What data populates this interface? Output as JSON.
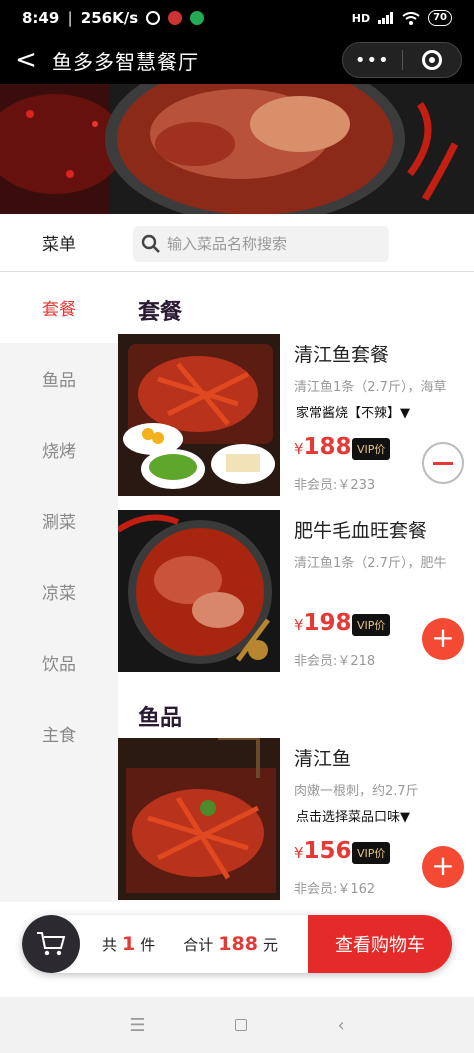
{
  "status_bar": {
    "time": "8:49",
    "speed": "256K/s",
    "network": "HD",
    "battery": "70"
  },
  "nav": {
    "back_glyph": "<",
    "title": "鱼多多智慧餐厅",
    "more_glyph": "•••"
  },
  "search": {
    "menu_tab": "菜单",
    "placeholder": "输入菜品名称搜索"
  },
  "sidebar": {
    "items": [
      "套餐",
      "鱼品",
      "烧烤",
      "涮菜",
      "凉菜",
      "饮品",
      "主食"
    ],
    "active_index": 0
  },
  "sections": [
    {
      "title": "套餐",
      "dishes": [
        {
          "name": "清江鱼套餐",
          "desc": "清江鱼1条（2.7斤），海草",
          "spec": "家常酱烧【不辣】▼",
          "yen": "¥",
          "price": "188",
          "vip": "VIP价",
          "member": "非会员:￥233",
          "action": "minus"
        },
        {
          "name": "肥牛毛血旺套餐",
          "desc": "清江鱼1条（2.7斤），肥牛",
          "spec": "",
          "yen": "¥",
          "price": "198",
          "vip": "VIP价",
          "member": "非会员:￥218",
          "action": "plus"
        }
      ]
    },
    {
      "title": "鱼品",
      "dishes": [
        {
          "name": "清江鱼",
          "desc": "肉嫩一根刺，约2.7斤",
          "spec": "点击选择菜品口味▼",
          "yen": "¥",
          "price": "156",
          "vip": "VIP价",
          "member": "非会员:￥162",
          "action": "plus"
        }
      ]
    }
  ],
  "cart": {
    "prefix": "共",
    "count": "1",
    "unit": "件",
    "total_label": "合计",
    "total": "188",
    "currency": "元",
    "checkout": "查看购物车",
    "plus_glyph": "+"
  },
  "colors": {
    "accent": "#e53935",
    "checkout_bg": "#e52a2a",
    "plus_btn": "#f44a33"
  }
}
